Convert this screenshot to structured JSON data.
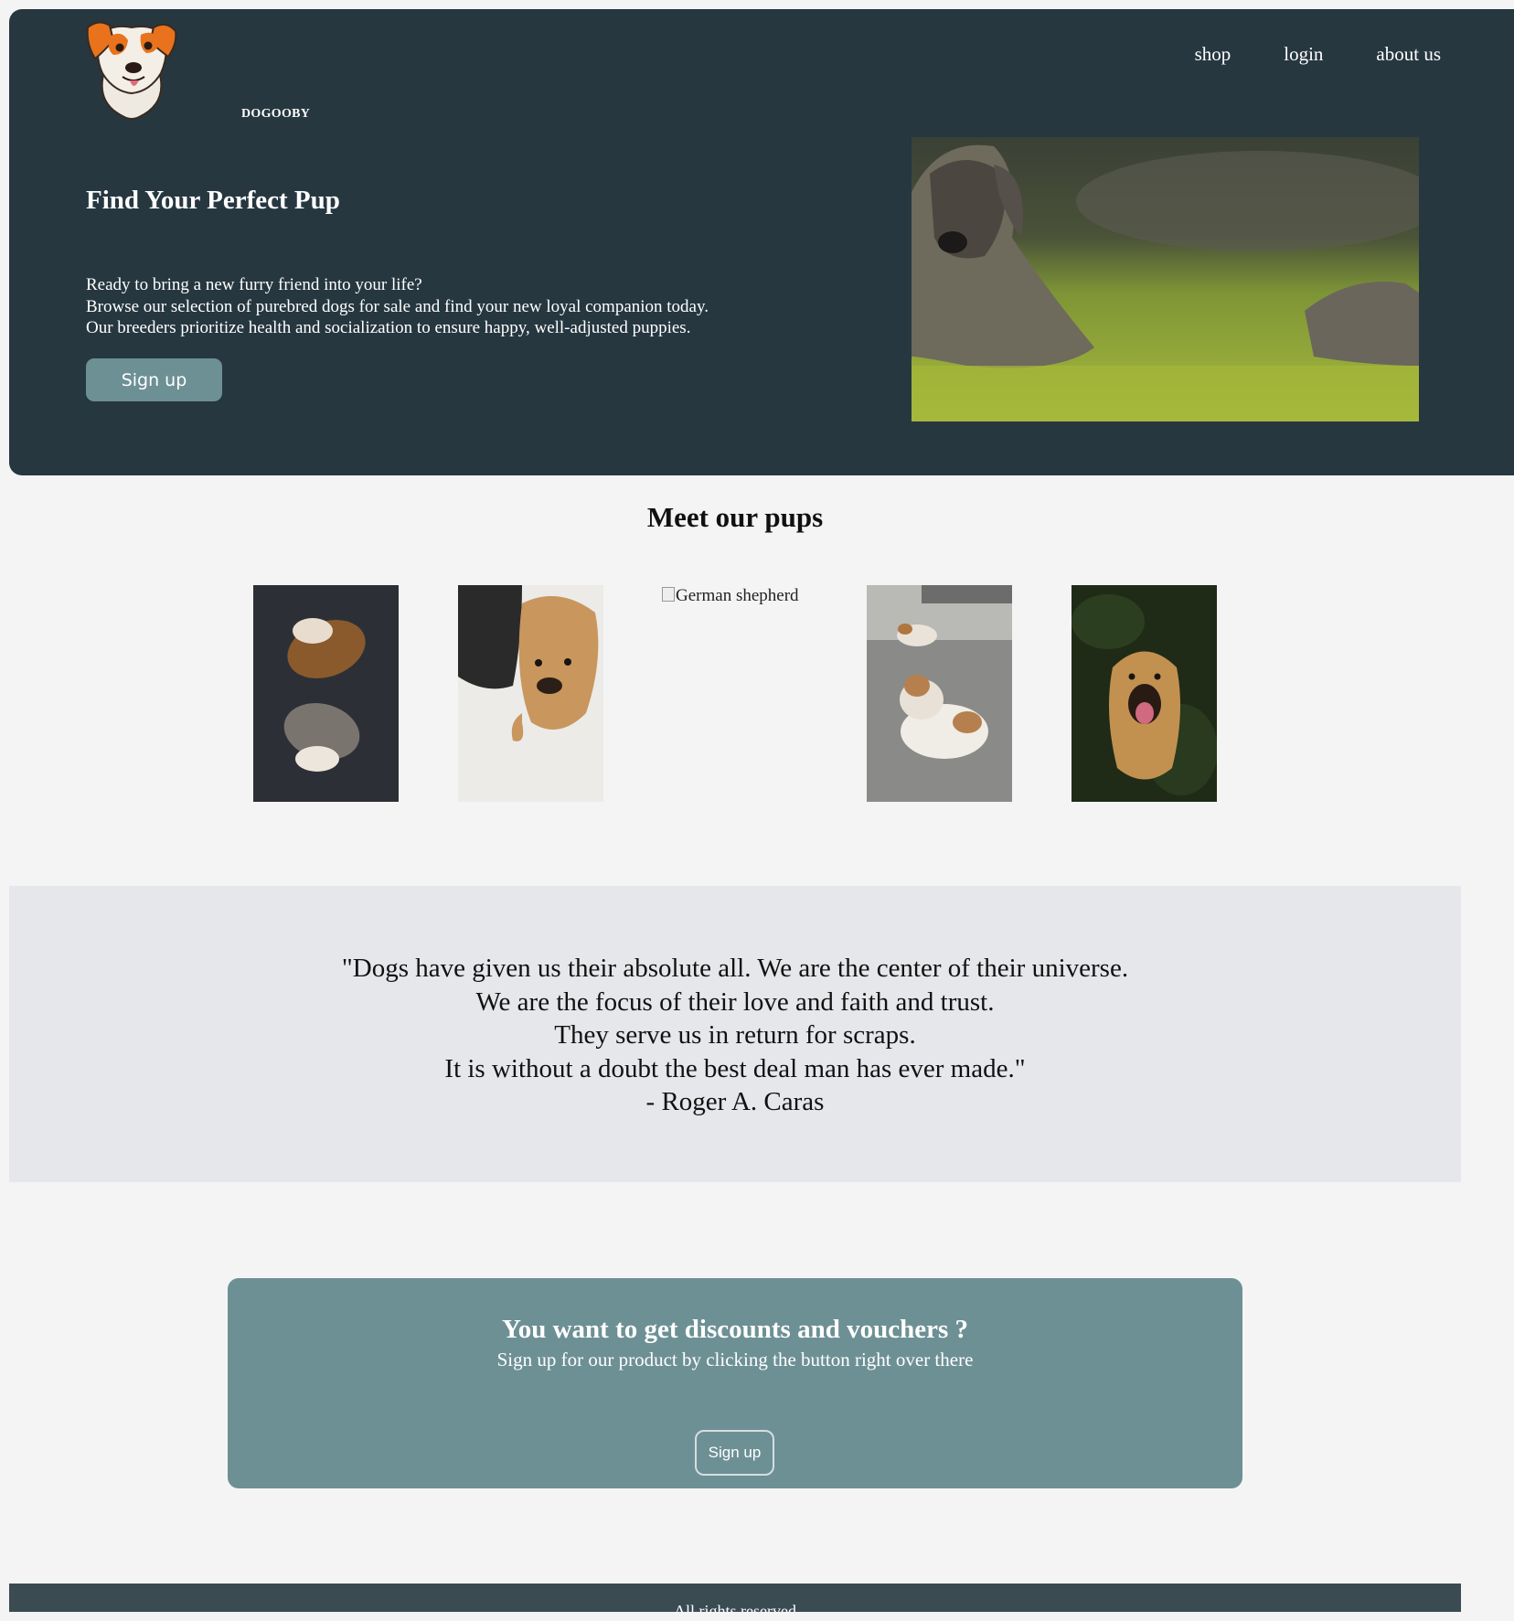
{
  "brand": {
    "name": "DOGOOBY"
  },
  "nav": {
    "items": [
      "shop",
      "login",
      "about us"
    ]
  },
  "hero": {
    "title": "Find Your Perfect Pup",
    "lines": [
      "Ready to bring a new furry friend into your life?",
      "Browse our selection of purebred dogs for sale and find your new loyal companion today.",
      "Our breeders prioritize health and socialization to ensure happy, well-adjusted puppies."
    ],
    "signup_label": "Sign up"
  },
  "pups": {
    "title": "Meet our pups",
    "broken_alt": "German shepherd"
  },
  "quote": {
    "lines": [
      "\"Dogs have given us their absolute all. We are the center of their universe.",
      "We are the focus of their love and faith and trust.",
      "They serve us in return for scraps.",
      "It is without a doubt the best deal man has ever made.\"",
      "- Roger A. Caras"
    ]
  },
  "cta": {
    "title": "You want to get discounts and vouchers ?",
    "subtitle": "Sign up for our product by clicking the button right over there",
    "signup_label": "Sign up"
  },
  "footer": {
    "text": "All rights reserved"
  },
  "colors": {
    "hero_bg": "#263740",
    "accent": "#6d9095",
    "quote_bg": "#e6e7ea",
    "footer_bg": "#3a4b52",
    "page_bg": "#f4f4f4"
  }
}
